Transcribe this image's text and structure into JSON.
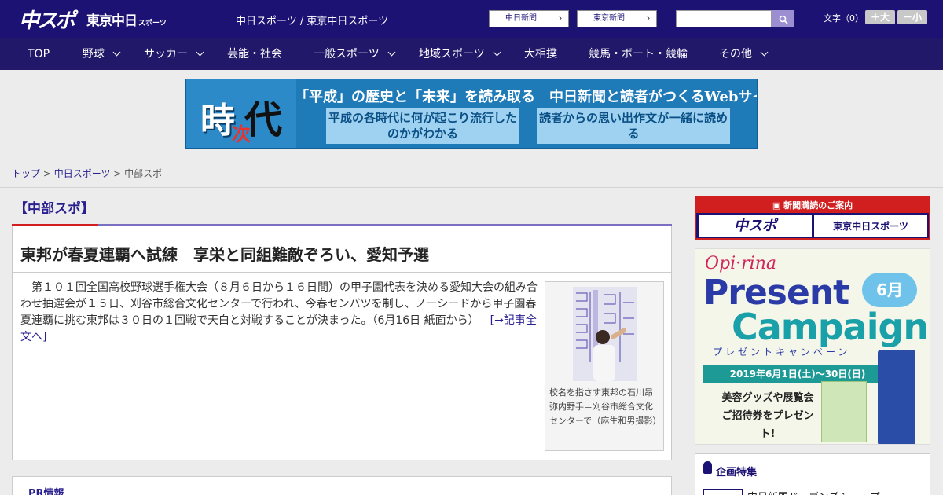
{
  "header": {
    "logo_main": "中スポ",
    "logo_tokyo": "東京中日",
    "logo_tokyo_small": "スポーツ",
    "site_link": "中日スポーツ / 東京中日スポーツ",
    "paper_buttons": [
      "中日新聞",
      "東京新聞"
    ],
    "search_placeholder": "",
    "font_size_label": "文字（0）",
    "font_bigger": "＋大",
    "font_smaller": "－小"
  },
  "nav": {
    "items": [
      {
        "label": "TOP",
        "has_menu": false
      },
      {
        "label": "野球",
        "has_menu": true
      },
      {
        "label": "サッカー",
        "has_menu": true
      },
      {
        "label": "芸能・社会",
        "has_menu": false
      },
      {
        "label": "一般スポーツ",
        "has_menu": true
      },
      {
        "label": "地域スポーツ",
        "has_menu": true
      },
      {
        "label": "大相撲",
        "has_menu": false
      },
      {
        "label": "競馬・ボート・競輪",
        "has_menu": false
      },
      {
        "label": "その他",
        "has_menu": true
      }
    ]
  },
  "banner": {
    "kanji_1": "時",
    "kanji_2": "次",
    "kanji_3": "代",
    "headline": "「平成」の歴史と「未来」を読み取る　中日新聞と読者がつくるWebサイト",
    "box_left": "平成の各時代に何が起こり流行したのかがわかる",
    "box_right": "読者からの思い出作文が一緒に読める"
  },
  "breadcrumb": {
    "home": "トップ",
    "sep": " > ",
    "parent": "中日スポーツ",
    "current": "中部スポ"
  },
  "section": {
    "title": "【中部スポ】"
  },
  "article": {
    "title": "東邦が春夏連覇へ試練　享栄と同組難敵ぞろい、愛知予選",
    "body": "第１０１回全国高校野球選手権大会（８月６日から１６日間）の甲子園代表を決める愛知大会の組み合わせ抽選会が１５日、刈谷市総合文化センターで行われ、今春センバツを制し、ノーシードから甲子園春夏連覇に挑む東邦は３０日の１回戦で天白と対戦することが決まった。（6月16日 紙面から）",
    "more_link": "[→記事全文へ]",
    "photo_caption": "校名を指さす東邦の石川昂弥内野手＝刈谷市総合文化センターで（麻生和男撮影）"
  },
  "pr": {
    "title": "PR情報"
  },
  "sidebar": {
    "subscribe_head": "新聞購読のご案内",
    "subscribe_logos": [
      "中スポ",
      "東京中日スポーツ"
    ],
    "ad": {
      "brand": "Opi·rina",
      "line1": "Present",
      "line2": "Campaign",
      "month": "6月",
      "kana": "プレゼントキャンペーン",
      "date": "2019年6月1日(土)〜30日(日)",
      "gift": "美容グッズや展覧会ご招待券をプレゼント!"
    },
    "feature_title": "企画特集",
    "feature_item": "中日新聞ドラゴンズショップ"
  },
  "colors": {
    "header_bg": "#1c1273",
    "nav_bg": "#211869",
    "accent_red": "#d11e1e",
    "link": "#2a1f8f"
  }
}
